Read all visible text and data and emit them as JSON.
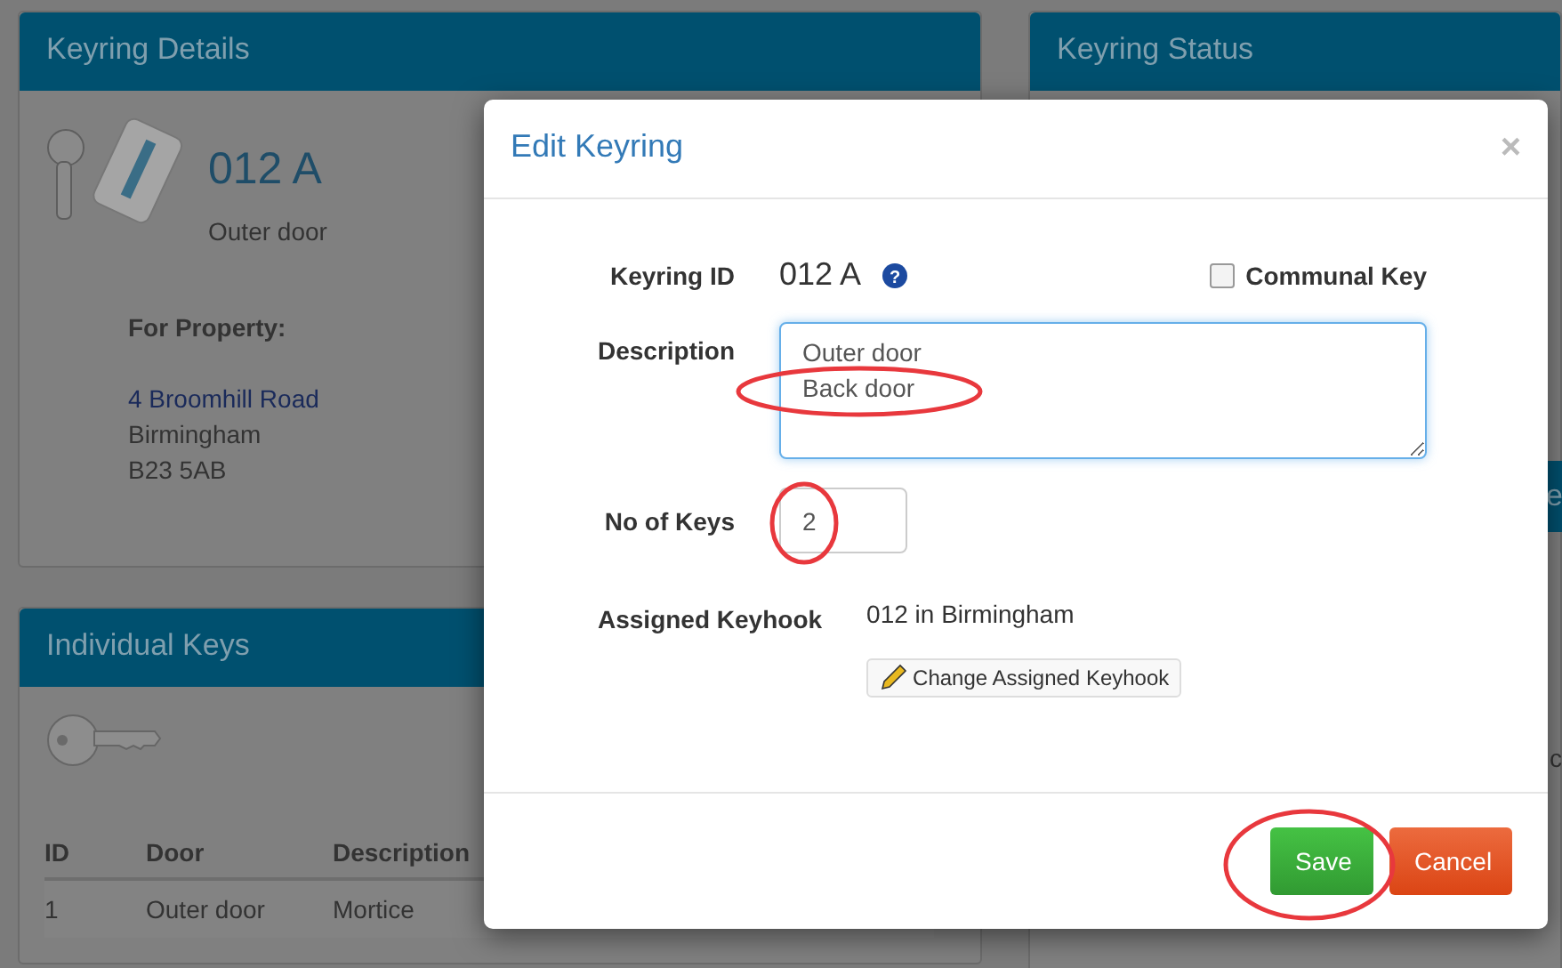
{
  "keyring_details": {
    "title": "Keyring Details",
    "keyring_id": "012 A",
    "description": "Outer door",
    "property_label": "For Property:",
    "address_link": "4 Broomhill Road",
    "address_lines": [
      "Birmingham",
      "B23 5AB"
    ]
  },
  "individual_keys": {
    "title": "Individual Keys",
    "columns": [
      "ID",
      "Door",
      "Description"
    ],
    "rows": [
      [
        "1",
        "Outer door",
        "Mortice"
      ]
    ]
  },
  "keyring_status": {
    "title": "Keyring Status",
    "button_partial": "e",
    "cell_partial": "c"
  },
  "dialog": {
    "title": "Edit Keyring",
    "close": "×",
    "keyring_id_label": "Keyring ID",
    "keyring_id": "012 A",
    "help": "?",
    "communal_key": {
      "label": "Communal Key",
      "checked": false
    },
    "description_label": "Description",
    "description": "Outer door\nBack door",
    "description_highlighted": true,
    "keys_label": "No of Keys",
    "keys": "2",
    "keys_highlighted": true,
    "keyhook_label": "Assigned Keyhook",
    "keyhook": "012 in Birmingham",
    "change_button": "Change Assigned Keyhook",
    "buttons": [
      {
        "label": "Save",
        "kind": "success",
        "highlighted": true
      },
      {
        "label": "Cancel",
        "kind": "danger",
        "highlighted": false
      }
    ]
  }
}
